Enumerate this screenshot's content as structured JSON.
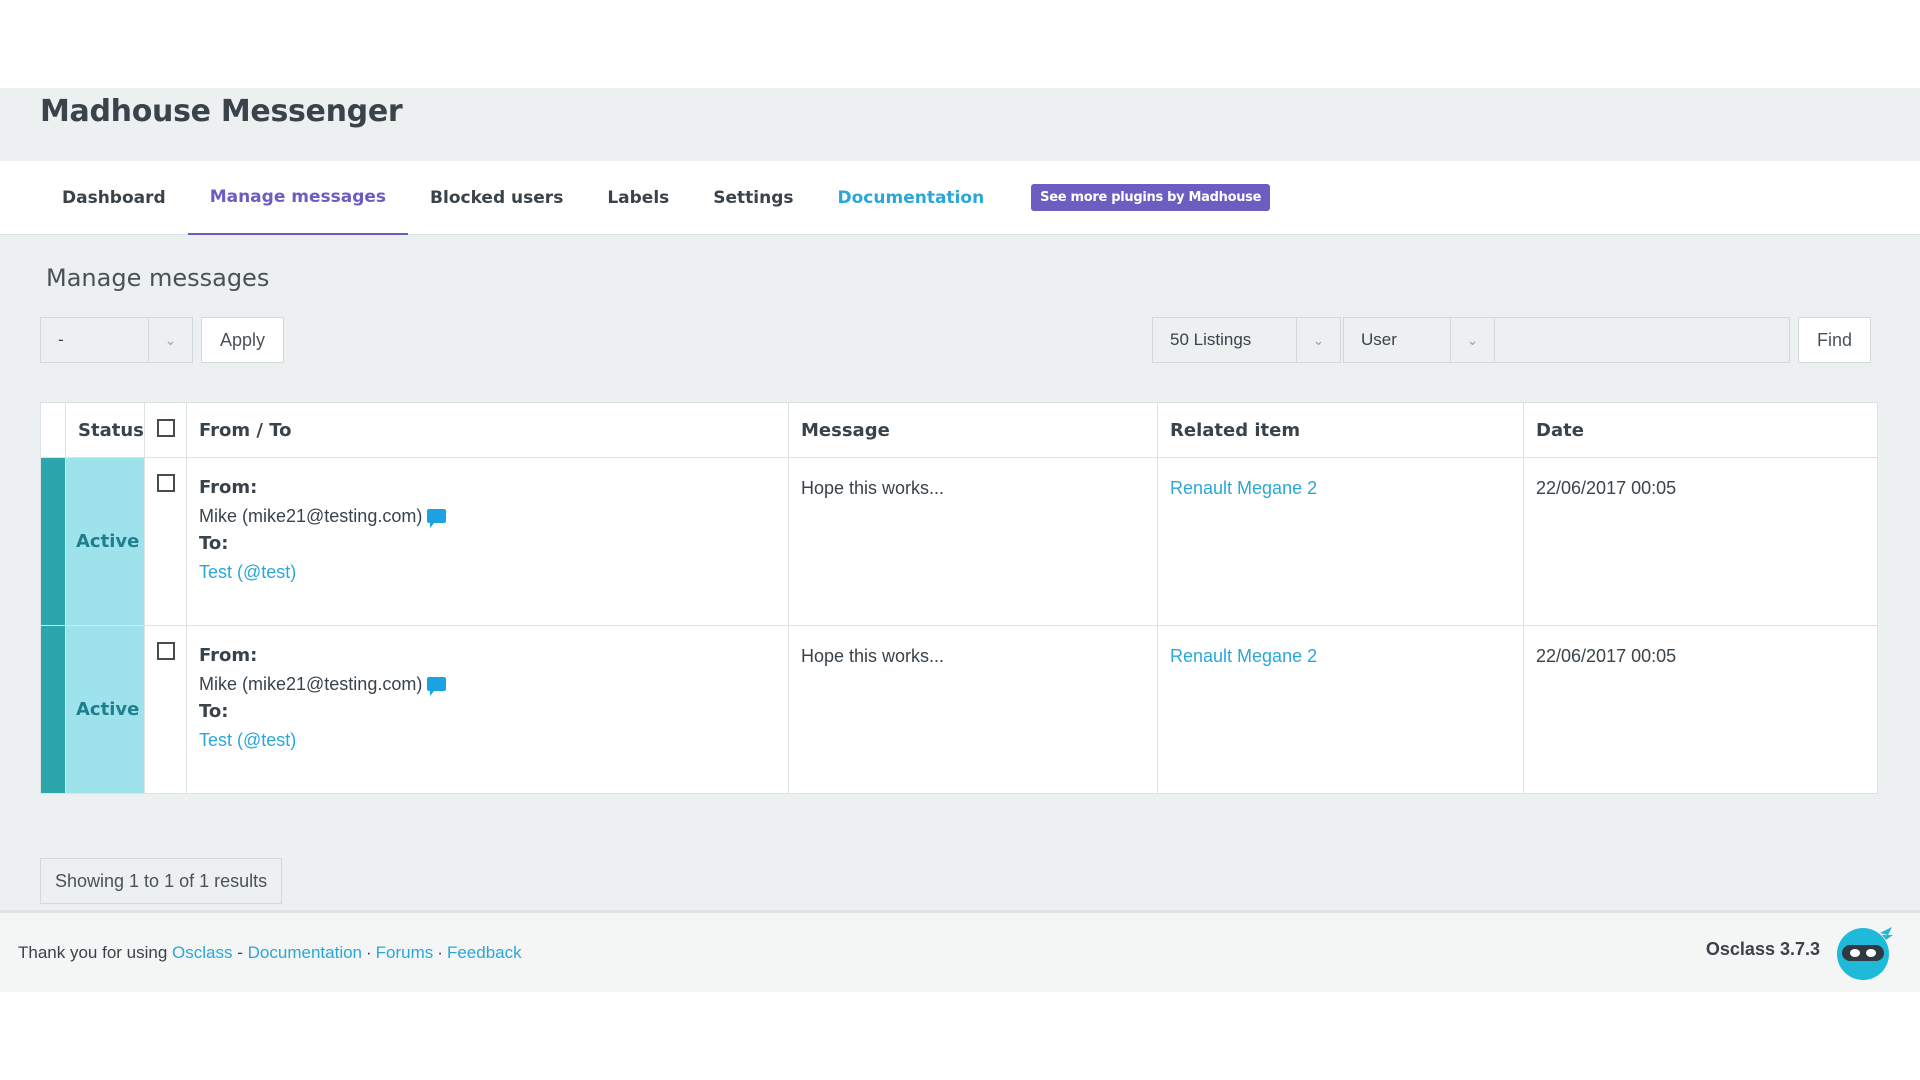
{
  "app": {
    "title": "Madhouse Messenger"
  },
  "tabs": [
    {
      "label": "Dashboard",
      "active": false
    },
    {
      "label": "Manage messages",
      "active": true
    },
    {
      "label": "Blocked users",
      "active": false
    },
    {
      "label": "Labels",
      "active": false
    },
    {
      "label": "Settings",
      "active": false
    },
    {
      "label": "Documentation",
      "active": false
    }
  ],
  "plugins_badge": "See more plugins by Madhouse",
  "section_title": "Manage messages",
  "controls": {
    "bulk_action_value": "-",
    "apply_label": "Apply",
    "listings_value": "50 Listings",
    "search_type_value": "User",
    "search_value": "",
    "find_label": "Find"
  },
  "table": {
    "headers": {
      "status": "Status",
      "from_to": "From / To",
      "message": "Message",
      "related_item": "Related item",
      "date": "Date"
    },
    "rows": [
      {
        "status": "Active",
        "from_label": "From:",
        "from_value": "Mike  (mike21@testing.com)",
        "to_label": "To:",
        "to_value": "Test (@test)",
        "message": "Hope this works...",
        "related_item": "Renault Megane 2",
        "date": "22/06/2017 00:05"
      },
      {
        "status": "Active",
        "from_label": "From:",
        "from_value": "Mike  (mike21@testing.com)",
        "to_label": "To:",
        "to_value": "Test (@test)",
        "message": "Hope this works...",
        "related_item": "Renault Megane 2",
        "date": "22/06/2017 00:05"
      }
    ]
  },
  "results_text": "Showing 1 to 1 of 1 results",
  "footer": {
    "thanks": "Thank you for using",
    "osclass": "Osclass",
    "dash": "-",
    "documentation": "Documentation",
    "dot1": "·",
    "forums": "Forums",
    "dot2": "·",
    "feedback": "Feedback",
    "version": "Osclass 3.7.3"
  },
  "colors": {
    "accent": "#6b5ec0",
    "link": "#2aa7d8",
    "status_active_bg": "#9ee3ec",
    "status_edge": "#2ba6ad"
  },
  "icons": {
    "caret": "chevron-down-icon",
    "chat": "chat-bubble-icon",
    "logo": "osclass-ninja-logo"
  }
}
